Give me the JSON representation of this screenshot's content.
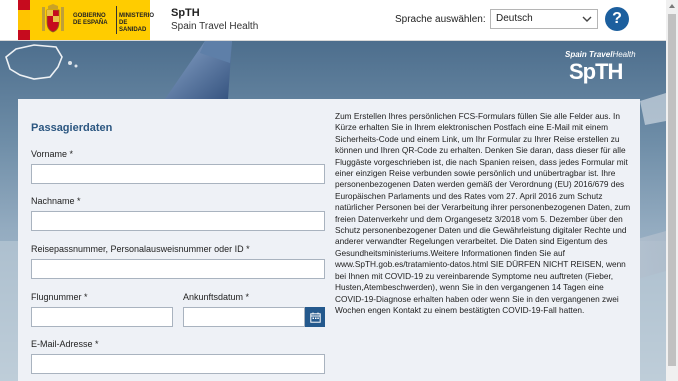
{
  "header": {
    "gov_line1": "GOBIERNO DE ESPAÑA",
    "gov_line2": "MINISTERIO DE SANIDAD",
    "brand_name": "SpTH",
    "brand_subtitle": "Spain Travel Health",
    "language_label": "Sprache auswählen:",
    "language_value": "Deutsch",
    "help_label": "?"
  },
  "logo": {
    "top_bold": "Spain Travel",
    "top_light": "Health",
    "main": "SpTH"
  },
  "form": {
    "section_title": "Passagierdaten",
    "first_name_label": "Vorname *",
    "last_name_label": "Nachname *",
    "passport_label": "Reisepassnummer, Personalausweisnummer oder ID *",
    "flight_label": "Flugnummer *",
    "arrival_label": "Ankunftsdatum *",
    "email_label": "E-Mail-Adresse *"
  },
  "info_text": "Zum Erstellen Ihres persönlichen FCS-Formulars füllen Sie alle Felder aus. In Kürze erhalten Sie in Ihrem elektronischen Postfach eine E-Mail mit einem Sicherheits-Code und einem Link, um Ihr Formular zu Ihrer Reise erstellen zu können und Ihren QR-Code zu erhalten. Denken Sie daran, dass dieser für alle Fluggäste vorgeschrieben ist, die nach Spanien reisen, dass jedes Formular mit einer einzigen Reise verbunden sowie persönlich und unübertragbar ist. Ihre personenbezogenen Daten werden gemäß der Verordnung (EU) 2016/679 des Europäischen Parlaments und des Rates vom 27. April 2016 zum Schutz natürlicher Personen bei der Verarbeitung ihrer personenbezogenen Daten, zum freien Datenverkehr und dem Organgesetz 3/2018 vom 5. Dezember über den Schutz personenbezogener Daten und die Gewährleistung digitaler Rechte und anderer verwandter Regelungen verarbeitet. Die Daten sind Eigentum des Gesundheitsministeriums.Weitere Informationen finden Sie auf www.SpTH.gob.es/tratamiento-datos.html SIE DÜRFEN NICHT REISEN, wenn bei Ihnen mit COVID-19 zu vereinbarende Symptome neu auftreten (Fieber, Husten,Atembeschwerden), wenn Sie in den vergangenen 14 Tagen eine COVID-19-Diagnose erhalten haben oder wenn Sie in den vergangenen zwei Wochen engen Kontakt zu einem bestätigten COVID-19-Fall hatten.",
  "colors": {
    "accent_blue": "#24598d",
    "gov_yellow": "#ffcc00",
    "section_title": "#2b5680"
  },
  "icons": {
    "help": "question-mark-icon",
    "calendar": "calendar-icon",
    "dropdown": "chevron-down-icon"
  }
}
